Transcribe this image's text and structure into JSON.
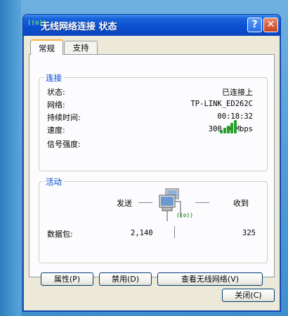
{
  "window": {
    "title": "无线网络连接  状态",
    "title_icon": "((o))",
    "help_label": "?",
    "close_label": "✕"
  },
  "tabs": [
    {
      "label": "常规",
      "active": true
    },
    {
      "label": "支持",
      "active": false
    }
  ],
  "connection": {
    "group_title": "连接",
    "rows": [
      {
        "label": "状态:",
        "value": "已连接上"
      },
      {
        "label": "网络:",
        "value": "TP-LINK_ED262C"
      },
      {
        "label": "持续时间:",
        "value": "00:18:32"
      },
      {
        "label": "速度:",
        "value": "300.0 Mbps"
      },
      {
        "label": "信号强度:",
        "value": ""
      }
    ],
    "signal_strength_bars": 5,
    "signal_strength_max": 5,
    "signal_color": "#27a12b"
  },
  "activity": {
    "group_title": "活动",
    "sent_label": "发送",
    "received_label": "收到",
    "packets_label": "数据包:",
    "packets_sent": "2,140",
    "packets_received": "325",
    "wireless_icon_text": "((o))"
  },
  "buttons": {
    "properties": "属性(P)",
    "disable": "禁用(D)",
    "view_networks": "查看无线网络(V)",
    "close": "关闭(C)"
  },
  "colors": {
    "title_blue": "#0a4fd0",
    "group_title": "#0046d5",
    "tab_highlight": "#f7b33e"
  }
}
